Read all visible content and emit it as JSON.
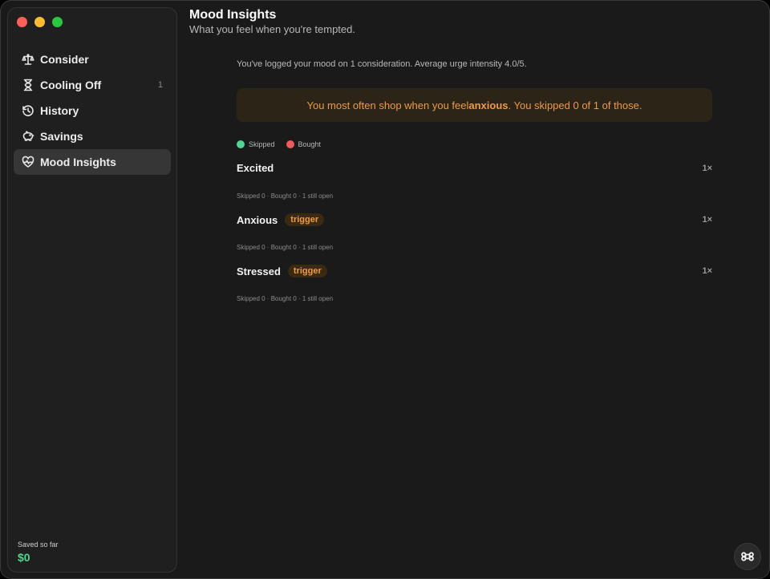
{
  "window": {
    "traffic_lights": [
      {
        "name": "close",
        "color": "#ff5f57"
      },
      {
        "name": "minimize",
        "color": "#febc2e"
      },
      {
        "name": "maximize",
        "color": "#28c840"
      }
    ]
  },
  "sidebar": {
    "items": [
      {
        "label": "Consider",
        "icon": "scale-icon",
        "badge": ""
      },
      {
        "label": "Cooling Off",
        "icon": "hourglass-icon",
        "badge": "1"
      },
      {
        "label": "History",
        "icon": "history-icon",
        "badge": ""
      },
      {
        "label": "Savings",
        "icon": "piggy-bank-icon",
        "badge": ""
      },
      {
        "label": "Mood Insights",
        "icon": "heart-pulse-icon",
        "badge": "",
        "active": true
      }
    ],
    "saved_label": "Saved so far",
    "saved_value": "$0"
  },
  "header": {
    "title": "Mood Insights",
    "subtitle": "What you feel when you're tempted."
  },
  "summary": "You've logged your mood on 1 consideration. Average urge intensity 4.0/5.",
  "banner": {
    "prefix": "You most often shop when you feel",
    "emphasis": "anxious",
    "suffix": ". You skipped 0 of 1 of those."
  },
  "legend": [
    {
      "label": "Skipped",
      "color": "#4fd68f"
    },
    {
      "label": "Bought",
      "color": "#f05a5a"
    }
  ],
  "moods": [
    {
      "name": "Excited",
      "trigger": "",
      "count": "1×",
      "stats": "Skipped 0 · Bought 0 · 1 still open"
    },
    {
      "name": "Anxious",
      "trigger": "trigger",
      "count": "1×",
      "stats": "Skipped 0 · Bought 0 · 1 still open"
    },
    {
      "name": "Stressed",
      "trigger": "trigger",
      "count": "1×",
      "stats": "Skipped 0 · Bought 0 · 1 still open"
    }
  ],
  "colors": {
    "accent_orange": "#f09a3e",
    "positive_green": "#4fd68f",
    "negative_red": "#f05a5a"
  }
}
